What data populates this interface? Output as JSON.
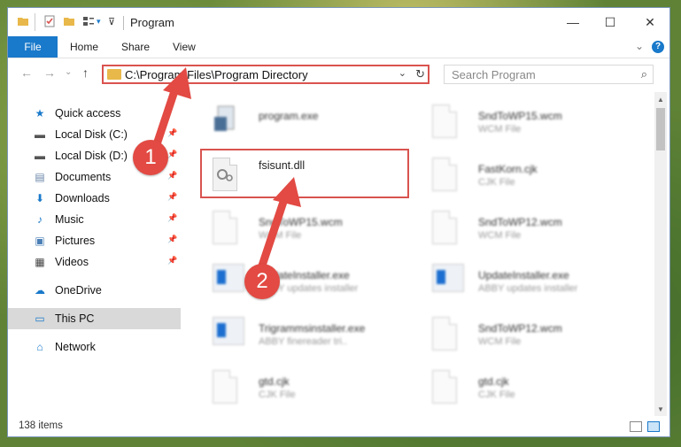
{
  "window": {
    "title": "Program",
    "controls": {
      "minimize": "—",
      "maximize": "☐",
      "close": "✕"
    }
  },
  "ribbon": {
    "tabs": [
      "File",
      "Home",
      "Share",
      "View"
    ],
    "expand_icon": "chevron-down-icon",
    "help_label": "?"
  },
  "navigation": {
    "back": "←",
    "forward": "→",
    "recent": "⌄",
    "up": "↑",
    "address": "C:\\Program Files\\Program Directory",
    "refresh": "↻",
    "search_placeholder": "Search Program"
  },
  "sidebar": {
    "items": [
      {
        "label": "Quick access",
        "icon": "star-icon",
        "color": "#1979ca",
        "pinned": false
      },
      {
        "label": "Local Disk (C:)",
        "icon": "drive-icon",
        "color": "#555555",
        "pinned": true
      },
      {
        "label": "Local Disk (D:)",
        "icon": "drive-icon",
        "color": "#555555",
        "pinned": true
      },
      {
        "label": "Documents",
        "icon": "documents-icon",
        "color": "#6a86a8",
        "pinned": true
      },
      {
        "label": "Downloads",
        "icon": "download-icon",
        "color": "#1979ca",
        "pinned": true
      },
      {
        "label": "Music",
        "icon": "music-icon",
        "color": "#1979ca",
        "pinned": true
      },
      {
        "label": "Pictures",
        "icon": "pictures-icon",
        "color": "#4a7fb5",
        "pinned": true
      },
      {
        "label": "Videos",
        "icon": "videos-icon",
        "color": "#444444",
        "pinned": true
      },
      {
        "label": "OneDrive",
        "icon": "cloud-icon",
        "color": "#1979ca",
        "pinned": false
      },
      {
        "label": "This PC",
        "icon": "pc-icon",
        "color": "#1979ca",
        "pinned": false,
        "selected": true
      },
      {
        "label": "Network",
        "icon": "network-icon",
        "color": "#1979ca",
        "pinned": false
      }
    ]
  },
  "files": [
    {
      "name": "program.exe",
      "type": "",
      "kind": "exe"
    },
    {
      "name": "SndToWP15.wcm",
      "type": "WCM File",
      "kind": "doc"
    },
    {
      "name": "fsisunt.dll",
      "type": "",
      "kind": "dll",
      "highlighted": true
    },
    {
      "name": "FastKorn.cjk",
      "type": "CJK File",
      "kind": "doc"
    },
    {
      "name": "SndToWP15.wcm",
      "type": "WCM File",
      "kind": "doc"
    },
    {
      "name": "SndToWP12.wcm",
      "type": "WCM File",
      "kind": "doc"
    },
    {
      "name": "UpdateInstaller.exe",
      "type": "ABBY updates installer",
      "kind": "installer"
    },
    {
      "name": "UpdateInstaller.exe",
      "type": "ABBY updates installer",
      "kind": "installer"
    },
    {
      "name": "Trigrammsinstaller.exe",
      "type": "ABBY finereader tri..",
      "kind": "installer"
    },
    {
      "name": "SndToWP12.wcm",
      "type": "WCM File",
      "kind": "doc"
    },
    {
      "name": "gtd.cjk",
      "type": "CJK File",
      "kind": "doc"
    },
    {
      "name": "gtd.cjk",
      "type": "CJK File",
      "kind": "doc"
    }
  ],
  "status": {
    "item_count": "138 items"
  },
  "annotations": {
    "step1": "1",
    "step2": "2",
    "color": "#e24a43"
  }
}
